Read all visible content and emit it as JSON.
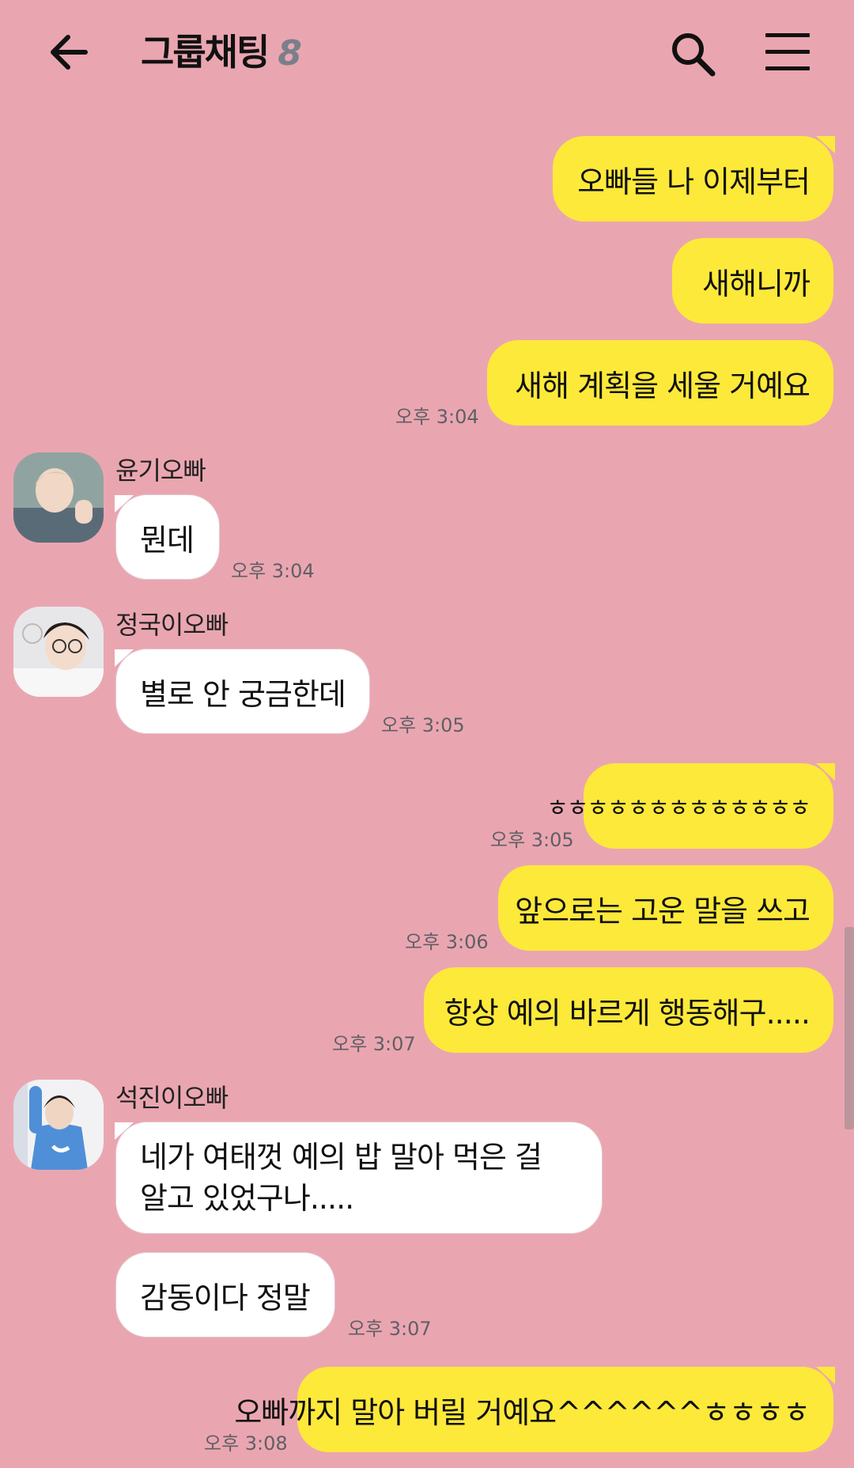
{
  "header": {
    "title": "그룹채팅",
    "member_count": "8",
    "back_icon": "arrow-left-icon",
    "search_icon": "search-icon",
    "menu_icon": "hamburger-menu-icon"
  },
  "colors": {
    "background": "#eaa6b0",
    "my_bubble": "#fde93a",
    "other_bubble": "#ffffff",
    "count": "#7a7f8a"
  },
  "messages": [
    {
      "sender": "me",
      "text": "오빠들 나 이제부터"
    },
    {
      "sender": "me",
      "text": "새해니까"
    },
    {
      "sender": "me",
      "text": "새해 계획을 세울 거예요",
      "time": "오후 3:04"
    },
    {
      "sender": "윤기오빠",
      "text": "뭔데",
      "time": "오후 3:04"
    },
    {
      "sender": "정국이오빠",
      "text": "별로 안 궁금한데",
      "time": "오후 3:05"
    },
    {
      "sender": "me",
      "text": "ㅎㅎㅎㅎㅎㅎㅎㅎㅎㅎㅎㅎㅎ",
      "time": "오후 3:05"
    },
    {
      "sender": "me",
      "text": "앞으로는 고운 말을 쓰고",
      "time": "오후 3:06"
    },
    {
      "sender": "me",
      "text": "항상 예의 바르게 행동해구.....",
      "time": "오후 3:07"
    },
    {
      "sender": "석진이오빠",
      "text_line1": "네가 여태껏 예의 밥 말아 먹은 걸",
      "text_line2": "알고 있었구나....."
    },
    {
      "sender": "석진이오빠",
      "text": "감동이다 정말",
      "time": "오후 3:07"
    },
    {
      "sender": "me",
      "text": "오빠까지 말아 버릴 거예요^^^^^^ㅎㅎㅎㅎ",
      "time": "오후 3:08"
    }
  ]
}
